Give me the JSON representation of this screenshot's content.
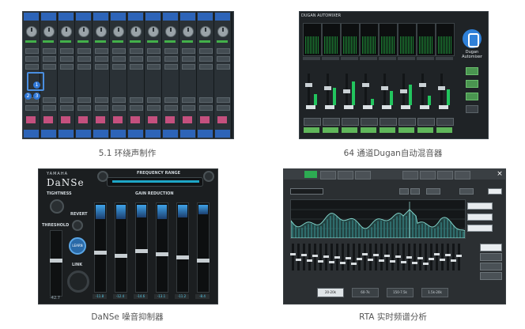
{
  "captions": [
    "5.1 环绕声制作",
    "64 通道Dugan自动混音器",
    "DaNSe 噪音抑制器",
    "RTA 实时频谱分析"
  ],
  "panel_dugan": {
    "title": "DUGAN AUTOMIXER",
    "brand_line1": "Dugan",
    "brand_line2": "Automixer"
  },
  "panel_danse": {
    "brand": "YAMAHA",
    "title": "DaNSe",
    "freq_label": "FREQUENCY RANGE",
    "labels": {
      "tightness": "TIGHTNESS",
      "revert": "REVERT",
      "threshold": "THRESHOLD",
      "learn": "LEARN",
      "link": "LINK",
      "gain_reduction": "GAIN REDUCTION"
    },
    "channel_values": [
      "-11.8",
      "-12.4",
      "-14.6",
      "-13.1",
      "-11.2",
      "-8.4"
    ],
    "threshold_value": "-42.7"
  },
  "panel_rta": {
    "bottom_buttons": [
      "20-20k",
      "60-7k",
      "150-7.5k",
      "1.5k-20k"
    ]
  },
  "colors": {
    "surround_blue": "#2d64b8",
    "meter_green": "#22c55e",
    "danse_blue": "#3fa3e8",
    "rta_accent": "#2dab52"
  }
}
